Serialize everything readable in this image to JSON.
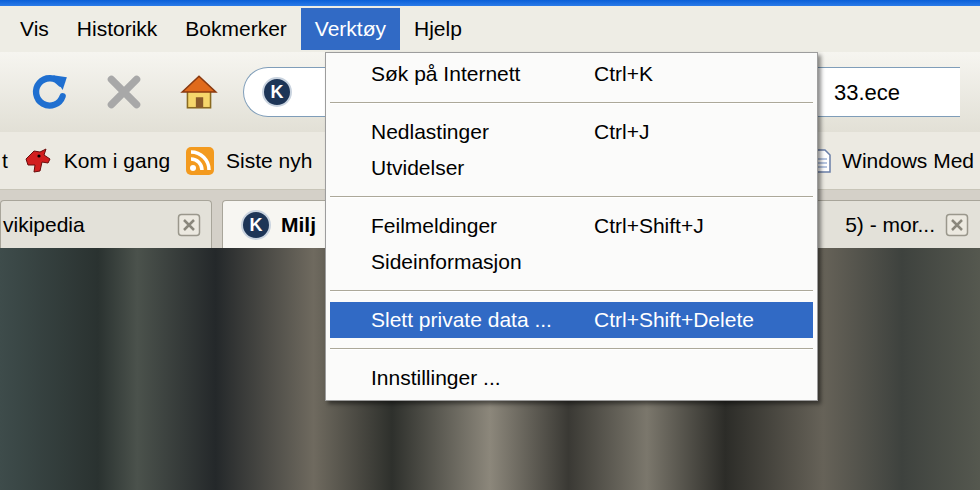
{
  "menu_bar": [
    {
      "label": "Vis",
      "selected": false
    },
    {
      "label": "Historikk",
      "selected": false
    },
    {
      "label": "Bokmerker",
      "selected": false
    },
    {
      "label": "Verktøy",
      "selected": true
    },
    {
      "label": "Hjelp",
      "selected": false
    }
  ],
  "toolbar": {
    "site_icon": "K",
    "address": "33.ece"
  },
  "bookmarks": [
    {
      "label": "t",
      "kind": "plain"
    },
    {
      "label": "Kom i gang",
      "kind": "dog"
    },
    {
      "label": "Siste nyh",
      "kind": "feed"
    },
    {
      "label": "Windows Med",
      "kind": "page"
    }
  ],
  "tabs": [
    {
      "label": "vikipedia",
      "selected": false
    },
    {
      "label": "Milj",
      "icon": "K",
      "selected": true
    },
    {
      "label": "5) - mor...",
      "selected": false
    }
  ],
  "menu": {
    "groups": [
      [
        {
          "label": "Søk på Internett",
          "shortcut": "Ctrl+K",
          "selected": false
        }
      ],
      [
        {
          "label": "Nedlastinger",
          "shortcut": "Ctrl+J",
          "selected": false
        },
        {
          "label": "Utvidelser",
          "shortcut": "",
          "selected": false
        }
      ],
      [
        {
          "label": "Feilmeldinger",
          "shortcut": "Ctrl+Shift+J",
          "selected": false
        },
        {
          "label": "Sideinformasjon",
          "shortcut": "",
          "selected": false
        }
      ],
      [
        {
          "label": "Slett private data ...",
          "shortcut": "Ctrl+Shift+Delete",
          "selected": true
        }
      ],
      [
        {
          "label": "Innstillinger ...",
          "shortcut": "",
          "selected": false
        }
      ]
    ]
  }
}
